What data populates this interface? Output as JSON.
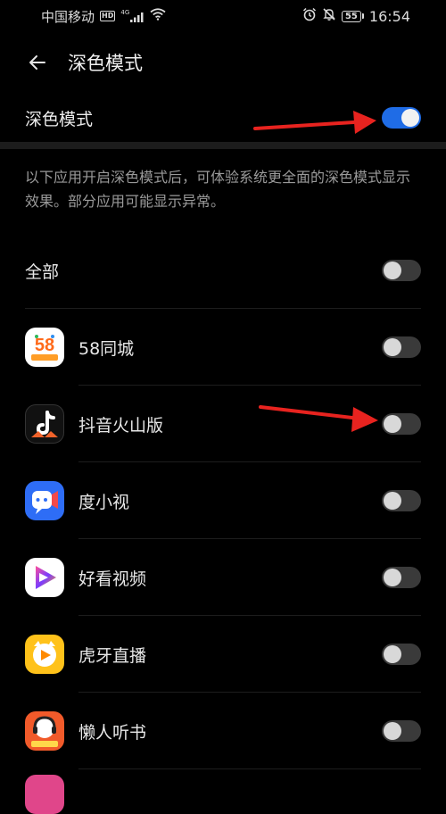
{
  "status_bar": {
    "carrier": "中国移动",
    "hd": "HD",
    "network": "4G",
    "battery": "55",
    "time": "16:54"
  },
  "header": {
    "title": "深色模式"
  },
  "master_toggle": {
    "label": "深色模式",
    "state": "on"
  },
  "description": "以下应用开启深色模式后，可体验系统更全面的深色模式显示效果。部分应用可能显示异常。",
  "all_row": {
    "label": "全部",
    "state": "off"
  },
  "apps": [
    {
      "label": "58同城",
      "icon": "58-tongcheng-icon",
      "icon_text": "58",
      "state": "off"
    },
    {
      "label": "抖音火山版",
      "icon": "douyin-huoshan-icon",
      "state": "off"
    },
    {
      "label": "度小视",
      "icon": "du-xiaoshi-icon",
      "state": "off"
    },
    {
      "label": "好看视频",
      "icon": "haokan-video-icon",
      "state": "off"
    },
    {
      "label": "虎牙直播",
      "icon": "huya-live-icon",
      "state": "off"
    },
    {
      "label": "懒人听书",
      "icon": "lanren-tingshu-icon",
      "state": "off"
    }
  ],
  "colors": {
    "background": "#000000",
    "toggle_on": "#1f6ce6",
    "toggle_off": "#3a3a3a",
    "annotation_arrow": "#e8231f"
  }
}
